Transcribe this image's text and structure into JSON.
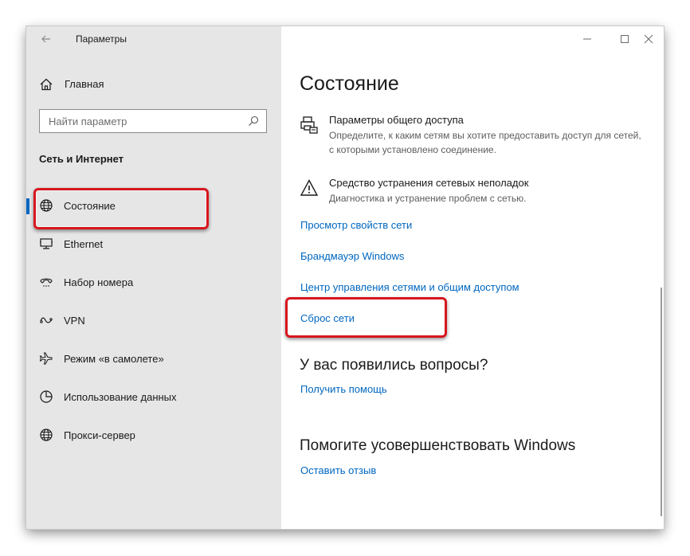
{
  "window": {
    "title": "Параметры",
    "controls": [
      "minimize-icon",
      "maximize-icon",
      "close-icon"
    ]
  },
  "sidebar": {
    "home_label": "Главная",
    "search_placeholder": "Найти параметр",
    "section_title": "Сеть и Интернет",
    "items": [
      {
        "label": "Состояние",
        "icon": "globe-icon",
        "active": true
      },
      {
        "label": "Ethernet",
        "icon": "ethernet-icon"
      },
      {
        "label": "Набор номера",
        "icon": "dialup-icon"
      },
      {
        "label": "VPN",
        "icon": "vpn-icon"
      },
      {
        "label": "Режим «в самолете»",
        "icon": "airplane-icon"
      },
      {
        "label": "Использование данных",
        "icon": "data-usage-icon"
      },
      {
        "label": "Прокси-сервер",
        "icon": "globe-icon"
      }
    ]
  },
  "main": {
    "title": "Состояние",
    "sharing": {
      "title": "Параметры общего доступа",
      "desc": "Определите, к каким сетям вы хотите предоставить доступ для сетей, с которыми установлено соединение."
    },
    "troubleshoot": {
      "title": "Средство устранения сетевых неполадок",
      "desc": "Диагностика и устранение проблем с сетью."
    },
    "links": [
      "Просмотр свойств сети",
      "Брандмауэр Windows",
      "Центр управления сетями и общим доступом",
      "Сброс сети"
    ],
    "questions": {
      "title": "У вас появились вопросы?",
      "link": "Получить помощь"
    },
    "improve": {
      "title": "Помогите усовершенствовать Windows",
      "link": "Оставить отзыв"
    }
  },
  "colors": {
    "accent": "#0067c0",
    "highlight": "#d7161e",
    "sidebar_bg": "#e6e6e6"
  }
}
